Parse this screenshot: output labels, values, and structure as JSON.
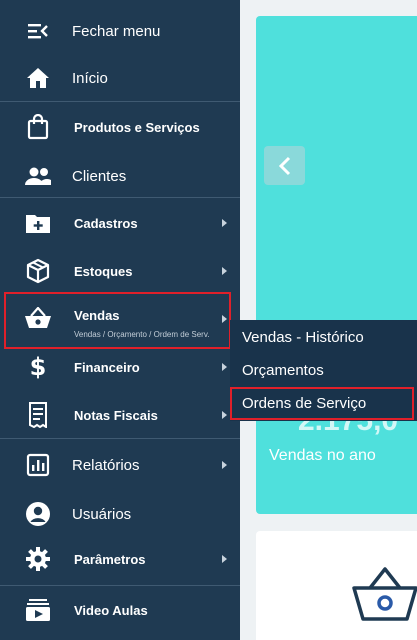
{
  "sidebar": {
    "items": [
      {
        "label": "Fechar menu",
        "icon": "menu-collapse-icon"
      },
      {
        "label": "Início",
        "icon": "home-icon"
      },
      {
        "label": "Produtos e Serviços",
        "icon": "shopping-bag-icon"
      },
      {
        "label": "Clientes",
        "icon": "users-icon"
      },
      {
        "label": "Cadastros",
        "icon": "folder-plus-icon"
      },
      {
        "label": "Estoques",
        "icon": "box-icon"
      },
      {
        "label": "Vendas",
        "icon": "basket-icon",
        "sublabel": "Vendas / Orçamento / Ordem de Serv."
      },
      {
        "label": "Financeiro",
        "icon": "dollar-icon"
      },
      {
        "label": "Notas Fiscais",
        "icon": "receipt-icon"
      },
      {
        "label": "Relatórios",
        "icon": "chart-icon"
      },
      {
        "label": "Usuários",
        "icon": "user-circle-icon"
      },
      {
        "label": "Parâmetros",
        "icon": "gear-icon"
      },
      {
        "label": "Video Aulas",
        "icon": "video-icon"
      }
    ]
  },
  "submenu": {
    "items": [
      "Vendas - Histórico",
      "Orçamentos",
      "Ordens de Serviço"
    ]
  },
  "main": {
    "card_value": "2.175,0",
    "card_label": "Vendas no ano"
  },
  "colors": {
    "sidebar": "#1f3a52",
    "teal": "#4fe0dc",
    "highlight": "#e0202a"
  }
}
